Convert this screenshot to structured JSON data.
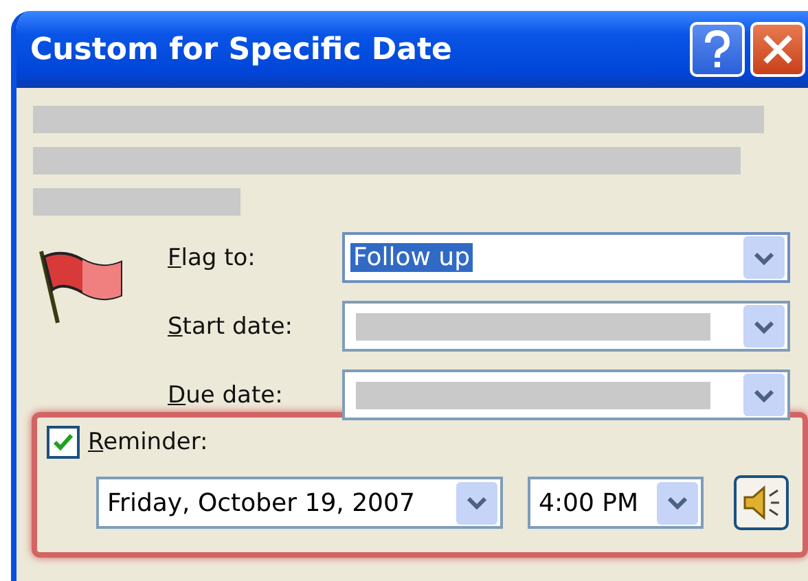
{
  "window": {
    "title": "Custom for Specific Date"
  },
  "fields": [
    {
      "label": "Flag to:",
      "value": "Follow up",
      "selected": true
    },
    {
      "label": "Start date:",
      "selected": false
    },
    {
      "label": "Due date:",
      "selected": false
    }
  ],
  "reminder": {
    "label": "Reminder:",
    "checked": true,
    "date": "Friday, October 19, 2007",
    "time": "4:00 PM"
  }
}
